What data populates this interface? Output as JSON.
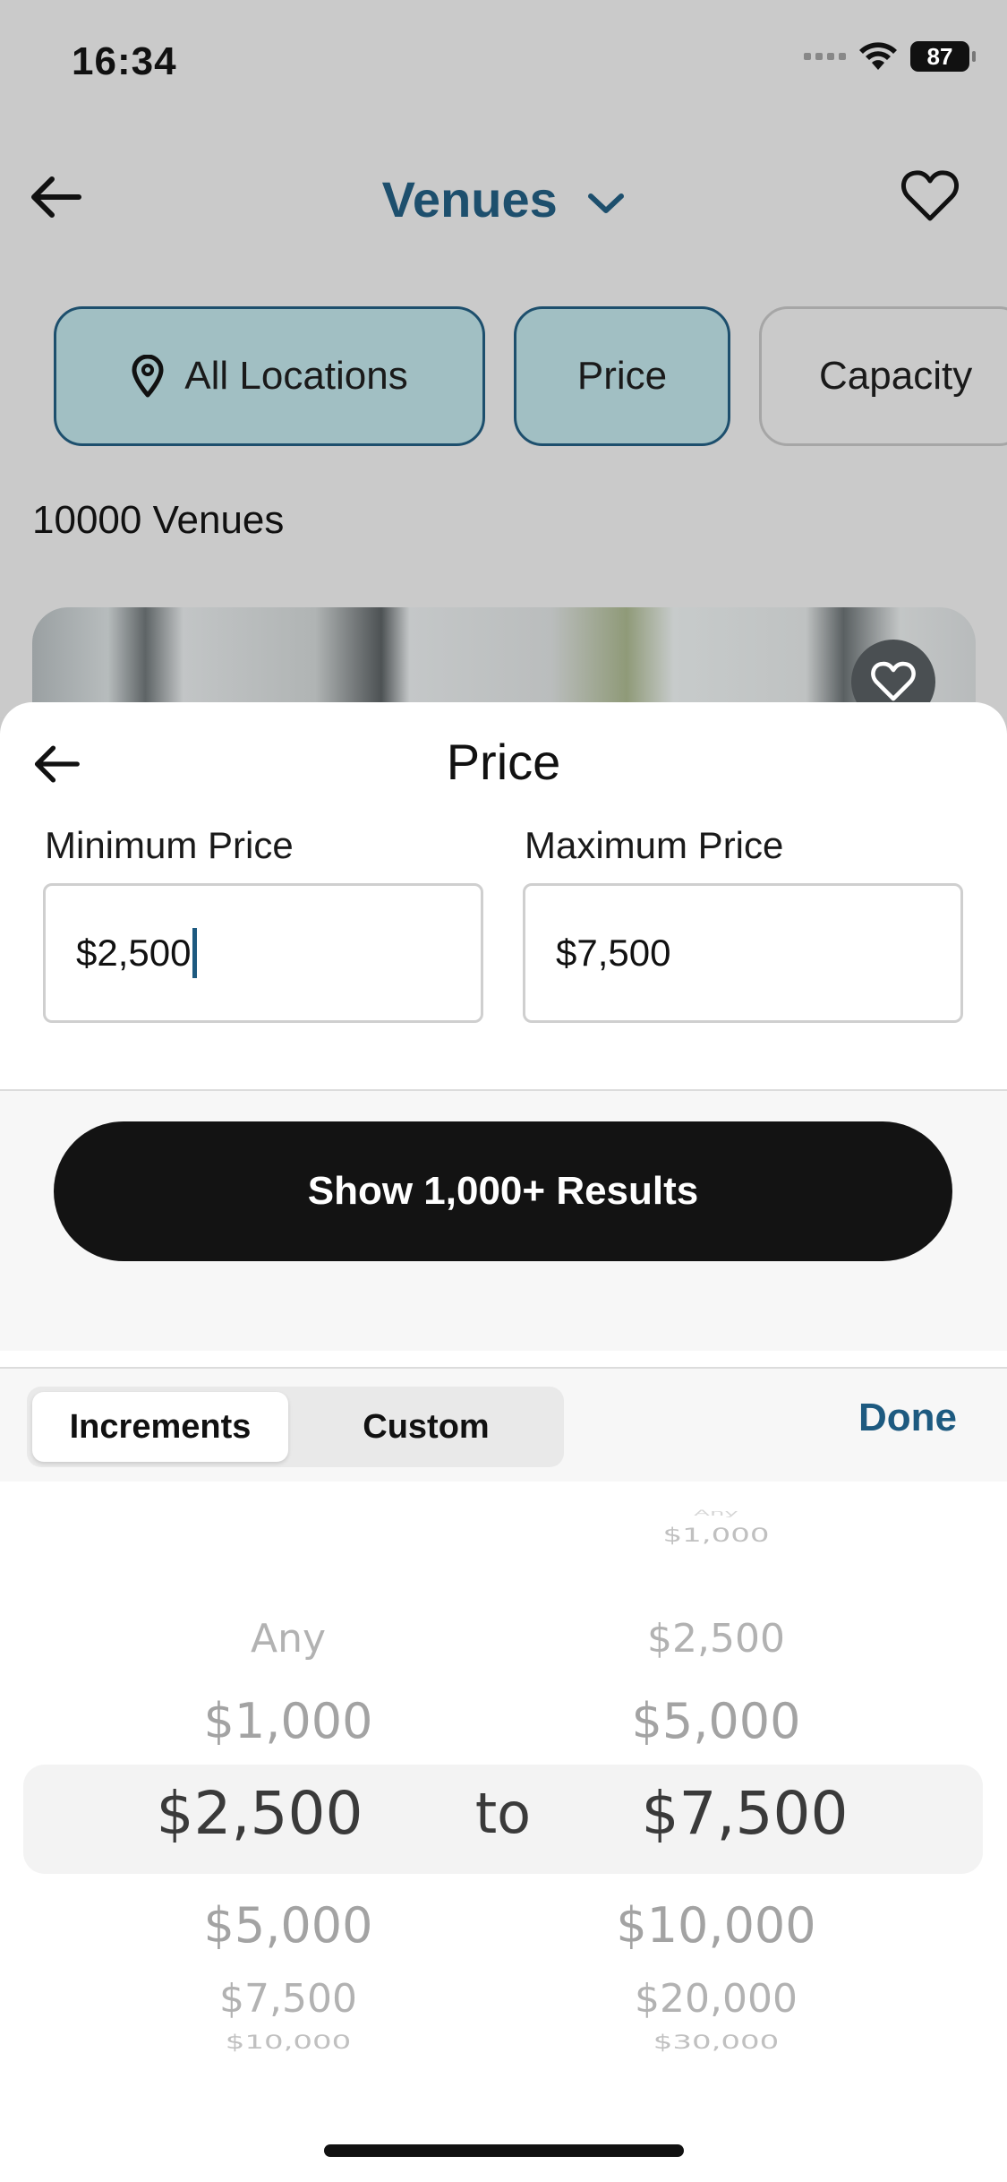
{
  "status_bar": {
    "time": "16:34",
    "battery": "87"
  },
  "header": {
    "title": "Venues"
  },
  "filters": {
    "location": "All Locations",
    "price": "Price",
    "capacity": "Capacity"
  },
  "venue_count": "10000 Venues",
  "sheet": {
    "title": "Price",
    "min_label": "Minimum Price",
    "max_label": "Maximum Price",
    "min_value": "$2,500",
    "max_value": "$7,500",
    "results_button": "Show 1,000+ Results"
  },
  "toolbar": {
    "tab_increments": "Increments",
    "tab_custom": "Custom",
    "done": "Done"
  },
  "picker": {
    "connector": "to",
    "left": {
      "above": [
        "Any",
        "$1,000"
      ],
      "selected": "$2,500",
      "below": [
        "$5,000",
        "$7,500",
        "$10,000"
      ]
    },
    "right": {
      "above": [
        "Any",
        "$1,000",
        "$2,500",
        "$5,000"
      ],
      "selected": "$7,500",
      "below": [
        "$10,000",
        "$20,000",
        "$30,000"
      ]
    }
  }
}
